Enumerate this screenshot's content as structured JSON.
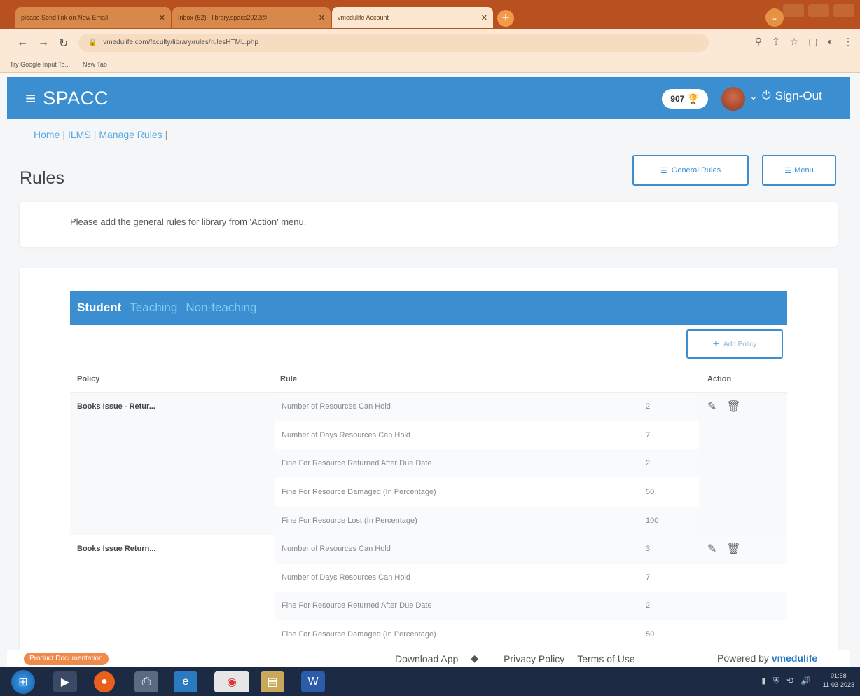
{
  "browser": {
    "tabs": [
      {
        "title": "please Send link on New Email",
        "active": false
      },
      {
        "title": "Inbox (52) - library.spacc2022@",
        "active": false
      },
      {
        "title": "vmedulife Account",
        "active": true
      }
    ],
    "new_tab_label": "+",
    "url": "vmedulife.com/faculty/library/rules/rulesHTML.php",
    "bookmarks": [
      "Try Google Input To...",
      "New Tab"
    ]
  },
  "app": {
    "brand": "SPACC",
    "points": "907",
    "signout_label": "Sign-Out",
    "breadcrumb": [
      "Home",
      "ILMS",
      "Manage Rules"
    ],
    "page_title": "Rules",
    "general_rules_button": "General Rules",
    "menu_button": "Menu",
    "info_text": "Please add the general rules for library from 'Action' menu.",
    "user_tabs": [
      {
        "label": "Student",
        "active": true
      },
      {
        "label": "Teaching",
        "active": false
      },
      {
        "label": "Non-teaching",
        "active": false
      }
    ],
    "add_policy_button": "Add Policy",
    "table": {
      "headers": {
        "policy": "Policy",
        "rule": "Rule",
        "action": "Action"
      },
      "groups": [
        {
          "policy": "Books Issue - Retur...",
          "rows": [
            {
              "rule": "Number of Resources Can Hold",
              "value": "2"
            },
            {
              "rule": "Number of Days Resources Can Hold",
              "value": "7"
            },
            {
              "rule": "Fine For Resource Returned After Due Date",
              "value": "2"
            },
            {
              "rule": "Fine For Resource Damaged (In Percentage)",
              "value": "50"
            },
            {
              "rule": "Fine For Resource Lost (In Percentage)",
              "value": "100"
            }
          ]
        },
        {
          "policy": "Books Issue Return...",
          "rows": [
            {
              "rule": "Number of Resources Can Hold",
              "value": "3"
            },
            {
              "rule": "Number of Days Resources Can Hold",
              "value": "7"
            },
            {
              "rule": "Fine For Resource Returned After Due Date",
              "value": "2"
            },
            {
              "rule": "Fine For Resource Damaged (In Percentage)",
              "value": "50"
            }
          ]
        }
      ]
    }
  },
  "footer": {
    "doc_badge": "Product Documentation",
    "download_app": "Download App",
    "privacy": "Privacy Policy",
    "terms": "Terms of Use",
    "powered_by": "Powered by",
    "brand": "vmedulife"
  },
  "taskbar": {
    "time": "01:58",
    "date": "11-03-2023"
  },
  "colors": {
    "primary": "#3b8fd0",
    "tab_inactive": "#7fd0f4",
    "browser_frame": "#b8501f"
  }
}
